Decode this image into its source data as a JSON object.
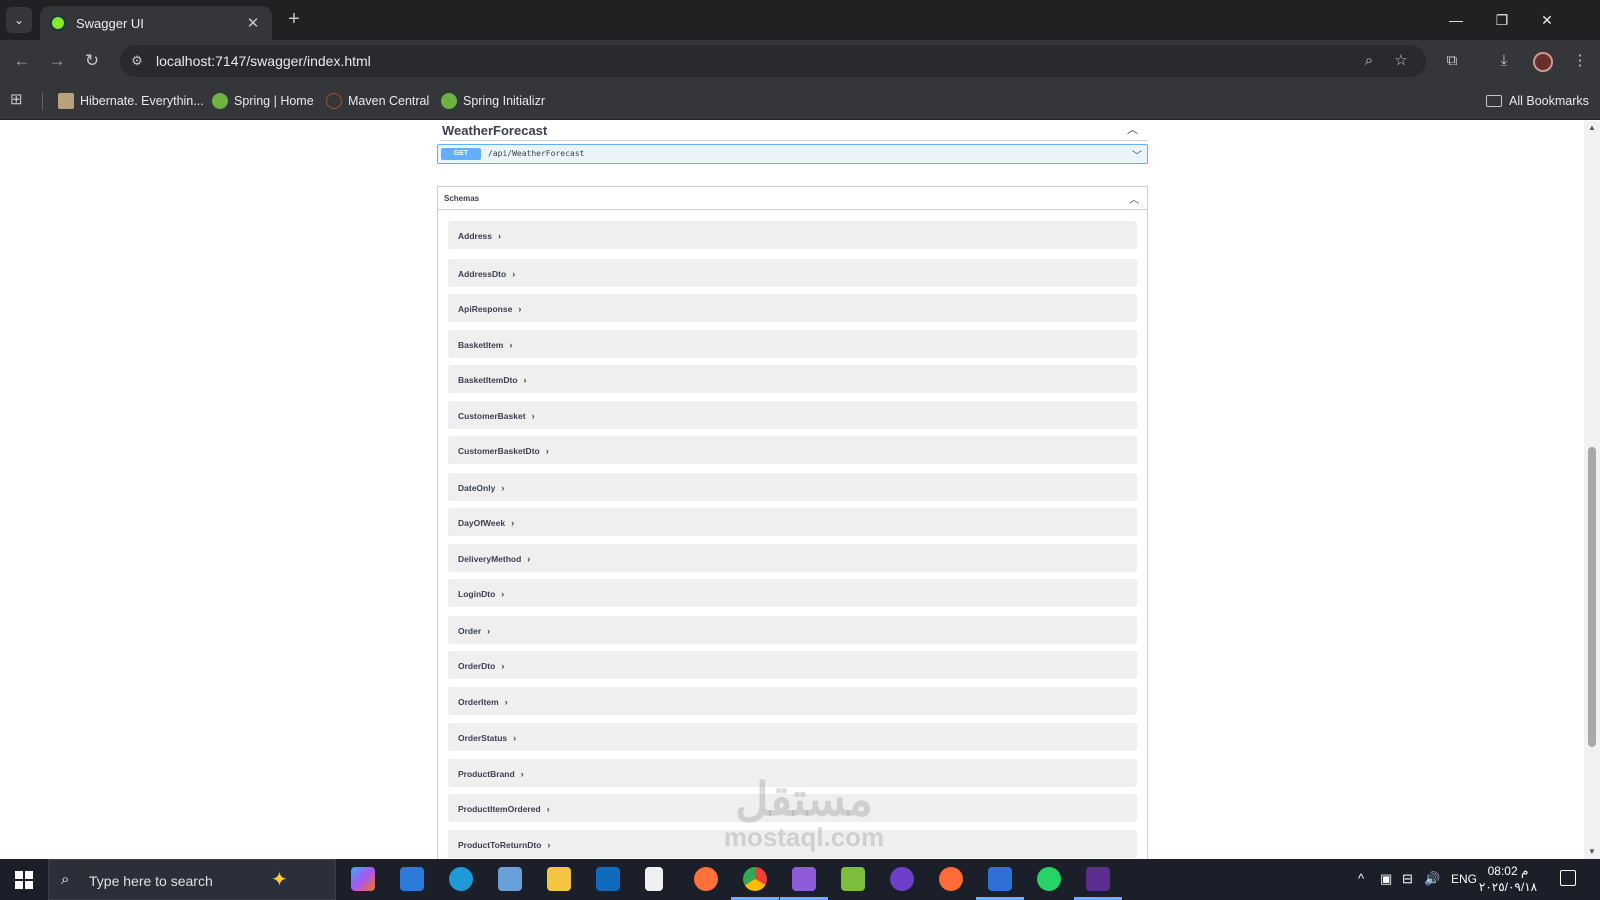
{
  "browser": {
    "tab": {
      "title": "Swagger UI",
      "favicon": "swagger-favicon-icon"
    },
    "address": "localhost:7147/swagger/index.html",
    "bookmarks": [
      {
        "label": "Hibernate. Everythin...",
        "icon": "hibernate-icon",
        "color": "#b8a27a"
      },
      {
        "label": "Spring | Home",
        "icon": "spring-icon",
        "color": "#6db33f"
      },
      {
        "label": "Maven Central",
        "icon": "maven-icon",
        "color": "#a0522d"
      },
      {
        "label": "Spring Initializr",
        "icon": "spring-initializr-icon",
        "color": "#6db33f"
      }
    ],
    "all_bookmarks": "All Bookmarks"
  },
  "swagger": {
    "tag": "WeatherForecast",
    "operation": {
      "method": "GET",
      "path": "/api/WeatherForecast",
      "color": "#61affe"
    },
    "schemas_title": "Schemas",
    "schemas": [
      "Address",
      "AddressDto",
      "ApiResponse",
      "BasketItem",
      "BasketItemDto",
      "CustomerBasket",
      "CustomerBasketDto",
      "DateOnly",
      "DayOfWeek",
      "DeliveryMethod",
      "LoginDto",
      "Order",
      "OrderDto",
      "OrderItem",
      "OrderStatus",
      "ProductBrand",
      "ProductItemOrdered",
      "ProductToReturnDto"
    ]
  },
  "watermark": {
    "arabic": "مستقل",
    "latin": "mostaql.com"
  },
  "taskbar": {
    "search_placeholder": "Type here to search",
    "language": "ENG",
    "time": "08:02 م",
    "date": "٢٠٢٥/٠٩/١٨"
  }
}
